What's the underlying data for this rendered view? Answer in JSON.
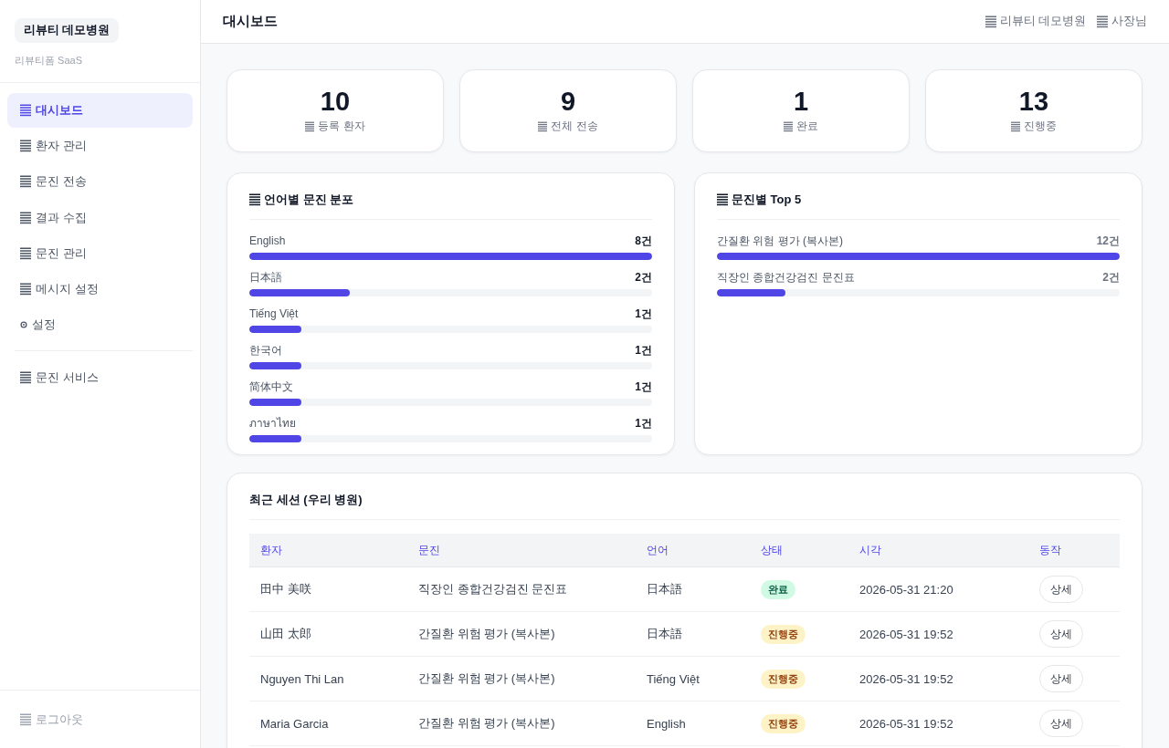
{
  "sidebar": {
    "brand": "리뷰티 데모병원",
    "subtitle": "리뷰티폼 SaaS",
    "items": [
      {
        "label": "대시보드",
        "kind": "page",
        "selected": true
      },
      {
        "label": "환자 관리",
        "kind": "page",
        "selected": false
      },
      {
        "label": "문진 전송",
        "kind": "page",
        "selected": false
      },
      {
        "label": "결과 수집",
        "kind": "page",
        "selected": false
      },
      {
        "label": "문진 관리",
        "kind": "page",
        "selected": false
      },
      {
        "label": "메시지 설정",
        "kind": "page",
        "selected": false
      },
      {
        "label": "설정",
        "kind": "settings",
        "selected": false
      }
    ],
    "extra_items": [
      {
        "label": "문진 서비스",
        "kind": "page",
        "selected": false
      }
    ],
    "logout": "로그아웃"
  },
  "header": {
    "title": "대시보드",
    "user_info": [
      "리뷰티 데모병원",
      "사장님"
    ]
  },
  "stats": [
    {
      "value": "10",
      "label": "등록 환자"
    },
    {
      "value": "9",
      "label": "전체 전송"
    },
    {
      "value": "1",
      "label": "완료"
    },
    {
      "value": "13",
      "label": "진행중"
    }
  ],
  "language_card": {
    "title": "언어별 문진 분포",
    "rows": [
      {
        "label": "English",
        "count": "8건",
        "level": 1
      },
      {
        "label": "日本語",
        "count": "2건",
        "level": 0.25
      },
      {
        "label": "Tiếng Việt",
        "count": "1건",
        "level": 0.13
      },
      {
        "label": "한국어",
        "count": "1건",
        "level": 0.13
      },
      {
        "label": "简体中文",
        "count": "1건",
        "level": 0.13
      },
      {
        "label": "ภาษาไทย",
        "count": "1건",
        "level": 0.13
      }
    ]
  },
  "top5_card": {
    "title": "문진별 Top 5",
    "rows": [
      {
        "label": "간질환 위험 평가 (복사본)",
        "count": "12건",
        "level": 1
      },
      {
        "label": "직장인 종합건강검진 문진표",
        "count": "2건",
        "level": 0.17
      }
    ]
  },
  "sessions": {
    "title": "최근 세션 (우리 병원)",
    "columns": [
      "환자",
      "문진",
      "언어",
      "상태",
      "시각",
      "동작"
    ],
    "rows": [
      {
        "patient": "田中 美咲",
        "survey": "직장인 종합건강검진 문진표",
        "language": "日本語",
        "status": {
          "label": "완료",
          "kind": "done"
        },
        "time": "2026-05-31 21:20",
        "action": "상세"
      },
      {
        "patient": "山田 太郎",
        "survey": "간질환 위험 평가 (복사본)",
        "language": "日本語",
        "status": {
          "label": "진행중",
          "kind": "progress"
        },
        "time": "2026-05-31 19:52",
        "action": "상세"
      },
      {
        "patient": "Nguyen Thi Lan",
        "survey": "간질환 위험 평가 (복사본)",
        "language": "Tiếng Việt",
        "status": {
          "label": "진행중",
          "kind": "progress"
        },
        "time": "2026-05-31 19:52",
        "action": "상세"
      },
      {
        "patient": "Maria Garcia",
        "survey": "간질환 위험 평가 (복사본)",
        "language": "English",
        "status": {
          "label": "진행중",
          "kind": "progress"
        },
        "time": "2026-05-31 19:52",
        "action": "상세"
      }
    ]
  }
}
